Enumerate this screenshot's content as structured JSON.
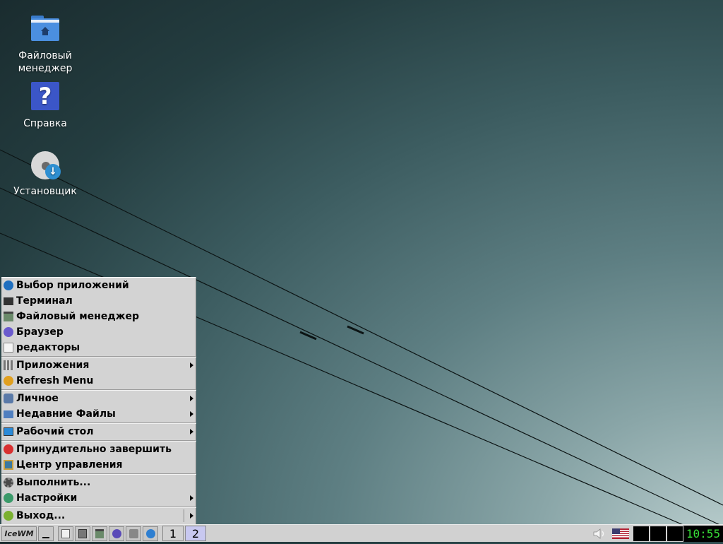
{
  "desktop": {
    "icons": [
      {
        "label_line1": "Файловый",
        "label_line2": "менеджер",
        "icon": "folder-home-icon"
      },
      {
        "label": "Справка",
        "icon": "help-icon"
      },
      {
        "label": "Установщик",
        "icon": "installer-icon"
      }
    ]
  },
  "menu": {
    "items": [
      {
        "label": "Выбор приложений",
        "icon": "app-finder-icon"
      },
      {
        "label": "Терминал",
        "icon": "terminal-icon"
      },
      {
        "label": "Файловый менеджер",
        "icon": "file-manager-icon"
      },
      {
        "label": "Браузер",
        "icon": "browser-icon"
      },
      {
        "label": "редакторы",
        "icon": "editor-icon"
      },
      {
        "label": "Приложения",
        "icon": "applications-icon",
        "submenu": true
      },
      {
        "label": "Refresh Menu",
        "icon": "refresh-icon"
      },
      {
        "label": "Личное",
        "icon": "personal-icon",
        "submenu": true
      },
      {
        "label": "Недавние Файлы",
        "icon": "recent-files-icon",
        "submenu": true
      },
      {
        "label": "Рабочий стол",
        "icon": "desktop-icon",
        "submenu": true
      },
      {
        "label": "Принудительно завершить",
        "icon": "force-quit-icon"
      },
      {
        "label": "Центр управления",
        "icon": "control-center-icon"
      },
      {
        "label": "Выполнить...",
        "icon": "run-icon"
      },
      {
        "label": "Настройки",
        "icon": "settings-icon",
        "submenu": true
      },
      {
        "label": "Выход...",
        "icon": "logout-icon",
        "submenu": true
      }
    ]
  },
  "taskbar": {
    "start_logo": "IceWM",
    "workspaces": [
      "1",
      "2"
    ],
    "active_workspace": "2",
    "clock": "10:55",
    "colors": {
      "clock_fg": "#39e039",
      "clock_bg": "#000000",
      "workspace_active": "#c8c8f0"
    }
  }
}
